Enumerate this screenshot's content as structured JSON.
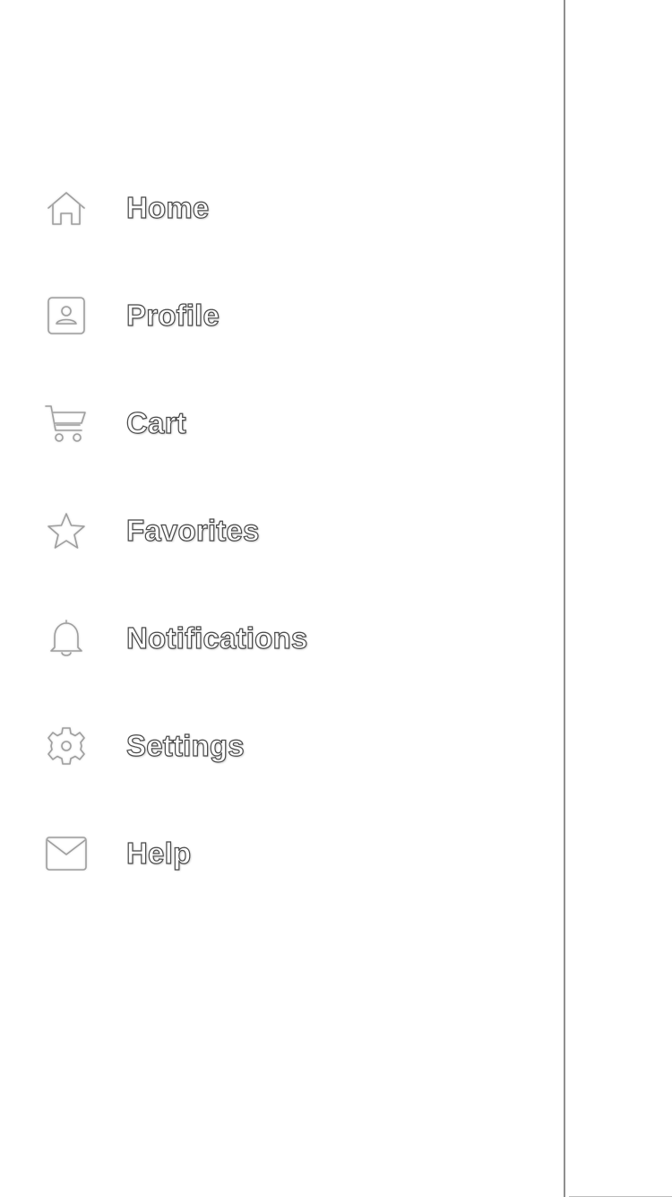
{
  "drawer": {
    "menu_items": [
      {
        "label": "Home",
        "icon": "home-icon"
      },
      {
        "label": "Profile",
        "icon": "profile-icon"
      },
      {
        "label": "Cart",
        "icon": "cart-icon"
      },
      {
        "label": "Favorites",
        "icon": "star-icon"
      },
      {
        "label": "Notifications",
        "icon": "bell-icon"
      },
      {
        "label": "Settings",
        "icon": "gear-icon"
      },
      {
        "label": "Help",
        "icon": "mail-icon"
      }
    ]
  },
  "colors": {
    "background": "#ffffff",
    "label_outline": "#4a4a4a",
    "icon_stroke": "#9e9e9e",
    "drawer_edge": "#8f8f8f"
  }
}
